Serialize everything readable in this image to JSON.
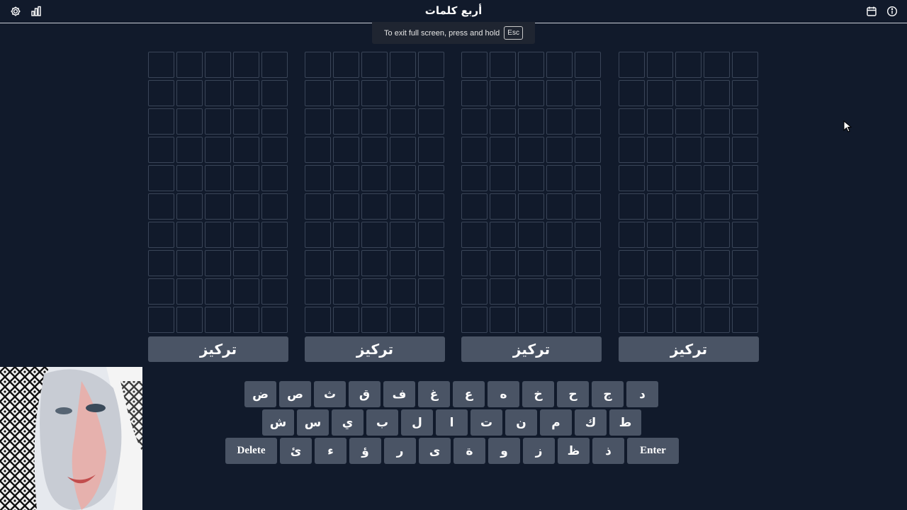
{
  "header": {
    "title": "أربع كلمات"
  },
  "icons": {
    "settings": "gear-icon",
    "stats": "bar-chart-icon",
    "calendar": "calendar-icon",
    "info": "info-icon"
  },
  "toast": {
    "text": "To exit full screen, press and hold",
    "key": "Esc"
  },
  "boards": [
    {
      "button_label": "تركيز"
    },
    {
      "button_label": "تركيز"
    },
    {
      "button_label": "تركيز"
    },
    {
      "button_label": "تركيز"
    }
  ],
  "keyboard": {
    "row1": [
      "ض",
      "ص",
      "ث",
      "ق",
      "ف",
      "غ",
      "ع",
      "ه",
      "خ",
      "ح",
      "ج",
      "د"
    ],
    "row2": [
      "ش",
      "س",
      "ي",
      "ب",
      "ل",
      "ا",
      "ت",
      "ن",
      "م",
      "ك",
      "ط"
    ],
    "row3": [
      "Delete",
      "ئ",
      "ء",
      "ؤ",
      "ر",
      "ى",
      "ة",
      "و",
      "ز",
      "ظ",
      "ذ",
      "Enter"
    ]
  },
  "colors": {
    "background": "#111a2b",
    "key": "#4a5465",
    "cell_border": "#3a4558"
  }
}
